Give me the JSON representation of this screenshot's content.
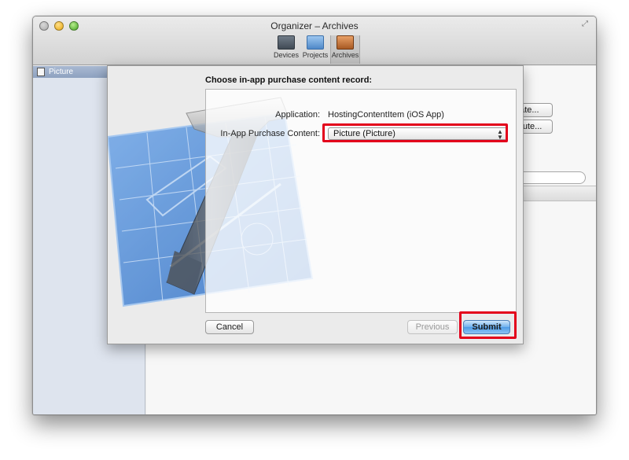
{
  "window": {
    "title": "Organizer – Archives"
  },
  "toolbar": {
    "items": [
      {
        "label": "Devices",
        "icon": "devices-icon"
      },
      {
        "label": "Projects",
        "icon": "projects-icon"
      },
      {
        "label": "Archives",
        "icon": "archives-icon",
        "selected": true
      }
    ]
  },
  "sidebar": {
    "items": [
      {
        "label": "Picture",
        "icon": "document-icon",
        "selected": true
      }
    ]
  },
  "main": {
    "validate_label": "Validate...",
    "distribute_label": "Distribute..."
  },
  "sheet": {
    "heading": "Choose in-app purchase content record:",
    "application_label": "Application:",
    "application_value": "HostingContentItem (iOS App)",
    "iap_label": "In-App Purchase Content:",
    "iap_selected": "Picture (Picture)",
    "cancel_label": "Cancel",
    "previous_label": "Previous",
    "submit_label": "Submit"
  },
  "colors": {
    "highlight": "#e3001b",
    "submit_accent": "#4d9be6"
  }
}
